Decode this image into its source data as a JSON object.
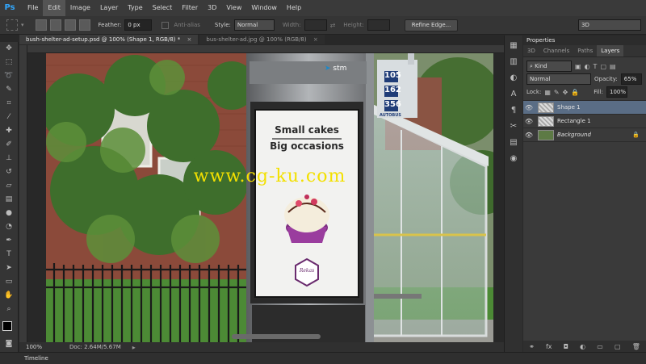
{
  "app": {
    "logo": "Ps"
  },
  "menu": [
    "File",
    "Edit",
    "Image",
    "Layer",
    "Type",
    "Select",
    "Filter",
    "3D",
    "View",
    "Window",
    "Help"
  ],
  "options": {
    "feather_label": "Feather:",
    "feather_value": "0 px",
    "antialias_label": "Anti-alias",
    "style_label": "Style:",
    "style_value": "Normal",
    "width_label": "Width:",
    "height_label": "Height:",
    "refine_label": "Refine Edge...",
    "workspace_value": "3D"
  },
  "tabs": [
    {
      "label": "bush-shelter-ad-setup.psd @ 100% (Shape 1, RGB/8) *",
      "close": "×"
    },
    {
      "label": "bus-shelter-ad.jpg @ 100% (RGB/8)",
      "close": "×"
    }
  ],
  "scene": {
    "brand": "stm",
    "poster_line1": "Small cakes",
    "poster_line2": "Big occasions",
    "poster_logo": "Rekas",
    "routes": [
      "105",
      "162",
      "356"
    ],
    "route_footer": "AUTOBUS",
    "watermark": "www.cg-ku.com"
  },
  "status": {
    "zoom": "100%",
    "doc": "Doc: 2.64M/5.67M"
  },
  "timeline": {
    "label": "Timeline"
  },
  "panel": {
    "title": "Properties",
    "tabs": [
      "3D",
      "Channels",
      "Paths",
      "Layers"
    ],
    "kind_value": "Kind",
    "blend_value": "Normal",
    "opacity_label": "Opacity:",
    "opacity_value": "65%",
    "lock_label": "Lock:",
    "fill_label": "Fill:",
    "fill_value": "100%",
    "layers": [
      {
        "name": "Shape 1",
        "selected": true
      },
      {
        "name": "Rectangle 1",
        "selected": false
      },
      {
        "name": "Background",
        "selected": false
      }
    ]
  }
}
